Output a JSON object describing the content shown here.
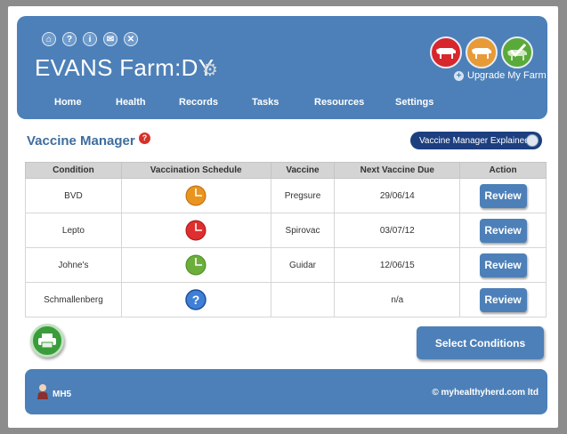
{
  "header": {
    "farm_name": "EVANS Farm:DY",
    "top_icons": [
      {
        "name": "home-icon",
        "glyph": "⌂"
      },
      {
        "name": "help-icon",
        "glyph": "?"
      },
      {
        "name": "info-icon",
        "glyph": "i"
      },
      {
        "name": "message-icon",
        "glyph": "✉"
      },
      {
        "name": "close-icon",
        "glyph": "✕"
      }
    ],
    "animal_icons": [
      {
        "name": "beef-cattle-icon",
        "color": "#d8262d"
      },
      {
        "name": "dairy-cattle-icon",
        "color": "#e89a36"
      },
      {
        "name": "check-cattle-icon",
        "color": "#5aaa3a"
      }
    ],
    "upgrade_label": "Upgrade My Farm"
  },
  "nav": {
    "items": [
      "Home",
      "Health",
      "Records",
      "Tasks",
      "Resources",
      "Settings"
    ]
  },
  "page": {
    "title": "Vaccine Manager",
    "help_badge": "?",
    "explained_label": "Vaccine Manager Explained"
  },
  "table": {
    "headers": [
      "Condition",
      "Vaccination Schedule",
      "Vaccine",
      "Next Vaccine Due",
      "Action"
    ],
    "rows": [
      {
        "condition": "BVD",
        "schedule_icon": "clock-orange",
        "schedule_color": "#e8941f",
        "vaccine": "Pregsure",
        "due": "29/06/14",
        "action": "Review"
      },
      {
        "condition": "Lepto",
        "schedule_icon": "clock-red",
        "schedule_color": "#de2e2e",
        "vaccine": "Spirovac",
        "due": "03/07/12",
        "action": "Review"
      },
      {
        "condition": "Johne's",
        "schedule_icon": "clock-green",
        "schedule_color": "#6cae3c",
        "vaccine": "Guidar",
        "due": "12/06/15",
        "action": "Review"
      },
      {
        "condition": "Schmallenberg",
        "schedule_icon": "question-blue",
        "schedule_color": "#3f7fd6",
        "vaccine": "",
        "due": "n/a",
        "action": "Review"
      }
    ]
  },
  "buttons": {
    "select_conditions": "Select Conditions"
  },
  "footer": {
    "user": "MH5",
    "copyright": "© myhealthyherd.com ltd"
  },
  "colors": {
    "primary": "#4d80b8",
    "dark_button": "#1d3f7f",
    "print_green": "#3a9c3a"
  }
}
